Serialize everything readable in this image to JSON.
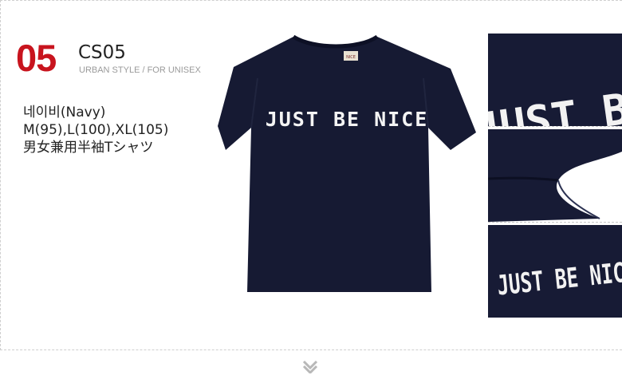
{
  "product": {
    "number": "05",
    "code": "CS05",
    "subtitle": "URBAN STYLE / FOR UNISEX"
  },
  "specs": {
    "lines": [
      "네이비(Navy)",
      "M(95),L(100),XL(105)",
      "男女兼用半袖Tシャツ"
    ]
  },
  "shirt": {
    "print_text": "JUST BE NICE",
    "neck_label": "NICE",
    "color": "#161a33"
  },
  "details": {
    "closeup_top_text": "JUST B",
    "closeup_bottom_text": "JUST BE NICE"
  },
  "colors": {
    "accent": "#c8141e"
  },
  "icons": {
    "next": "chevron-down-icon"
  }
}
